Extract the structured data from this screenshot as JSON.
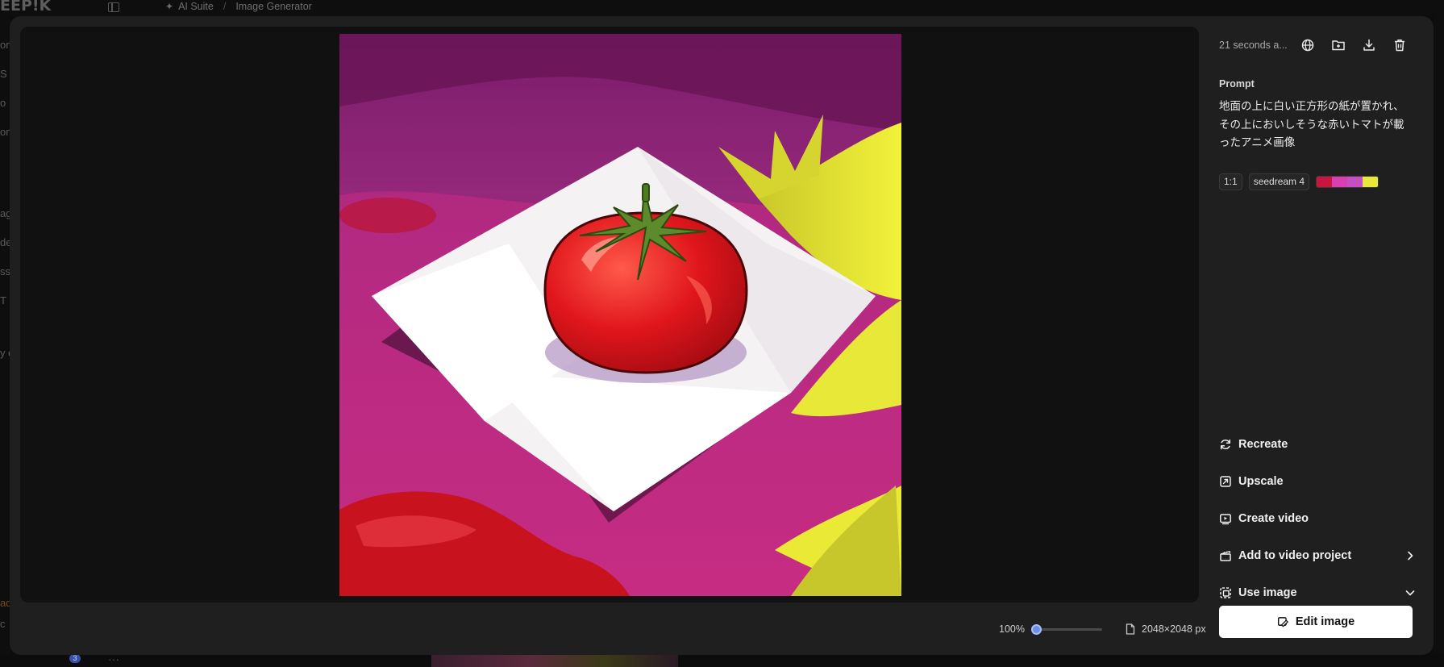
{
  "background": {
    "logo": "EEP!K",
    "breadcrumb": {
      "suite": "AI Suite",
      "separator": "/",
      "page": "Image Generator"
    },
    "left_fragments": [
      "om",
      "S",
      "o",
      "om",
      "ag",
      "de",
      "ssi",
      "T",
      "y c",
      "ad",
      "c"
    ],
    "notification_count": "3",
    "more_glyph": "···"
  },
  "viewer": {
    "zoom_label": "100%",
    "zoom_fraction": 0,
    "dimensions_label": "2048×2048 px"
  },
  "panel": {
    "timestamp": "21 seconds a...",
    "top_icons": [
      "globe-icon",
      "folder-add-icon",
      "download-icon",
      "trash-icon"
    ],
    "prompt_label": "Prompt",
    "prompt_text": "地面の上に白い正方形の紙が置かれ、その上においしそうな赤いトマトが載ったアニメ画像",
    "tags": {
      "aspect_ratio": "1:1",
      "model": "seedream 4"
    },
    "palette": [
      "#c8163f",
      "#d93fb0",
      "#c54ec0",
      "#e8e83a"
    ],
    "actions": [
      {
        "label": "Recreate",
        "icon": "refresh-icon"
      },
      {
        "label": "Upscale",
        "icon": "upscale-icon"
      },
      {
        "label": "Create video",
        "icon": "video-icon"
      },
      {
        "label": "Add to video project",
        "icon": "clapperboard-icon",
        "trail": "chevron-right-icon"
      },
      {
        "label": "Use image",
        "icon": "image-stack-icon",
        "trail": "chevron-down-icon"
      }
    ],
    "edit_button": "Edit image"
  }
}
